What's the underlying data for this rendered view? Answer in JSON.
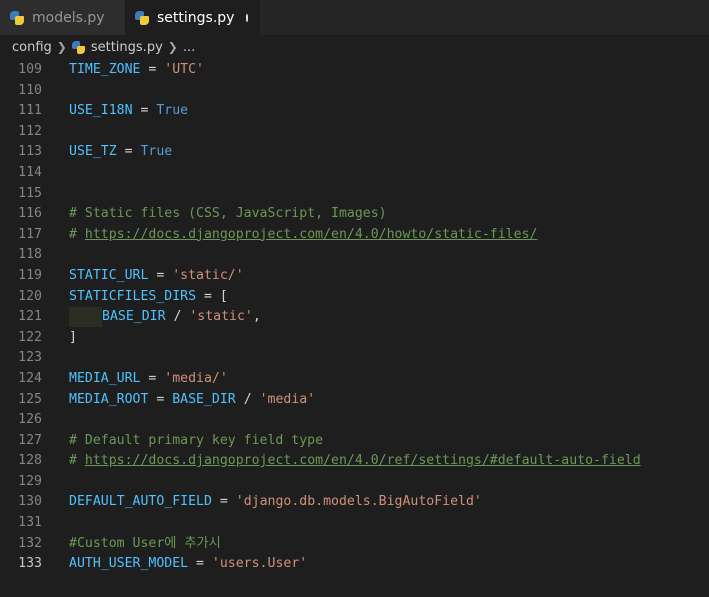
{
  "tabs": [
    {
      "label": "models.py",
      "active": false
    },
    {
      "label": "settings.py",
      "active": true,
      "modified": true
    }
  ],
  "breadcrumb": {
    "folder": "config",
    "file": "settings.py",
    "more": "..."
  },
  "colors": {
    "variable": "#4fc1ff",
    "string": "#ce9178",
    "keyword": "#569cd6",
    "comment": "#6a9955"
  },
  "lines": [
    {
      "n": "109",
      "tokens": [
        {
          "t": "TIME_ZONE",
          "c": "var"
        },
        {
          "t": " = ",
          "c": "op"
        },
        {
          "t": "'UTC'",
          "c": "str"
        }
      ]
    },
    {
      "n": "110",
      "tokens": []
    },
    {
      "n": "111",
      "tokens": [
        {
          "t": "USE_I18N",
          "c": "var"
        },
        {
          "t": " = ",
          "c": "op"
        },
        {
          "t": "True",
          "c": "kw"
        }
      ]
    },
    {
      "n": "112",
      "tokens": []
    },
    {
      "n": "113",
      "tokens": [
        {
          "t": "USE_TZ",
          "c": "var"
        },
        {
          "t": " = ",
          "c": "op"
        },
        {
          "t": "True",
          "c": "kw"
        }
      ]
    },
    {
      "n": "114",
      "tokens": []
    },
    {
      "n": "115",
      "tokens": []
    },
    {
      "n": "116",
      "tokens": [
        {
          "t": "# Static files (CSS, JavaScript, Images)",
          "c": "cmt"
        }
      ]
    },
    {
      "n": "117",
      "tokens": [
        {
          "t": "# ",
          "c": "cmt"
        },
        {
          "t": "https://docs.djangoproject.com/en/4.0/howto/static-files/",
          "c": "cmt link"
        }
      ]
    },
    {
      "n": "118",
      "tokens": []
    },
    {
      "n": "119",
      "tokens": [
        {
          "t": "STATIC_URL",
          "c": "var"
        },
        {
          "t": " = ",
          "c": "op"
        },
        {
          "t": "'static/'",
          "c": "str"
        }
      ]
    },
    {
      "n": "120",
      "tokens": [
        {
          "t": "STATICFILES_DIRS",
          "c": "var"
        },
        {
          "t": " = [",
          "c": "op"
        }
      ]
    },
    {
      "n": "121",
      "indent": true,
      "tokens": [
        {
          "t": "BASE_DIR",
          "c": "var"
        },
        {
          "t": " / ",
          "c": "op"
        },
        {
          "t": "'static'",
          "c": "str"
        },
        {
          "t": ",",
          "c": "op"
        }
      ]
    },
    {
      "n": "122",
      "tokens": [
        {
          "t": "]",
          "c": "op"
        }
      ]
    },
    {
      "n": "123",
      "tokens": []
    },
    {
      "n": "124",
      "tokens": [
        {
          "t": "MEDIA_URL",
          "c": "var"
        },
        {
          "t": " = ",
          "c": "op"
        },
        {
          "t": "'media/'",
          "c": "str"
        }
      ]
    },
    {
      "n": "125",
      "tokens": [
        {
          "t": "MEDIA_ROOT",
          "c": "var"
        },
        {
          "t": " = ",
          "c": "op"
        },
        {
          "t": "BASE_DIR",
          "c": "var"
        },
        {
          "t": " / ",
          "c": "op"
        },
        {
          "t": "'media'",
          "c": "str"
        }
      ]
    },
    {
      "n": "126",
      "tokens": []
    },
    {
      "n": "127",
      "tokens": [
        {
          "t": "# Default primary key field type",
          "c": "cmt"
        }
      ]
    },
    {
      "n": "128",
      "tokens": [
        {
          "t": "# ",
          "c": "cmt"
        },
        {
          "t": "https://docs.djangoproject.com/en/4.0/ref/settings/#default-auto-field",
          "c": "cmt link"
        }
      ]
    },
    {
      "n": "129",
      "tokens": []
    },
    {
      "n": "130",
      "tokens": [
        {
          "t": "DEFAULT_AUTO_FIELD",
          "c": "var"
        },
        {
          "t": " = ",
          "c": "op"
        },
        {
          "t": "'django.db.models.BigAutoField'",
          "c": "str"
        }
      ]
    },
    {
      "n": "131",
      "tokens": []
    },
    {
      "n": "132",
      "tokens": [
        {
          "t": "#Custom User에 추가시",
          "c": "cmt"
        }
      ]
    },
    {
      "n": "133",
      "current": true,
      "tokens": [
        {
          "t": "AUTH_USER_MODEL",
          "c": "var"
        },
        {
          "t": " = ",
          "c": "op"
        },
        {
          "t": "'users.User'",
          "c": "str"
        }
      ]
    }
  ]
}
